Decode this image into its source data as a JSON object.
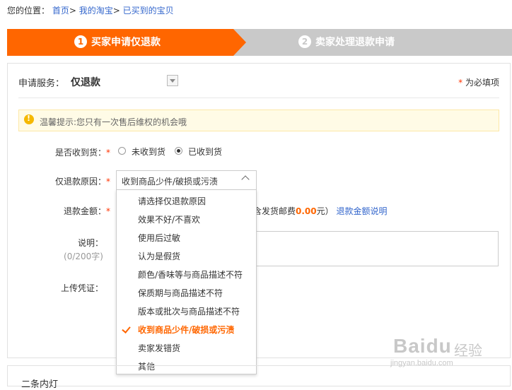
{
  "breadcrumb": {
    "prefix": "您的位置：",
    "items": [
      "首页",
      "我的淘宝",
      "已买到的宝贝"
    ],
    "sep": ">"
  },
  "steps": [
    {
      "num": "1",
      "label": "买家申请仅退款"
    },
    {
      "num": "2",
      "label": "卖家处理退款申请"
    }
  ],
  "service": {
    "label": "申请服务：",
    "value": "仅退款"
  },
  "required_note": {
    "star": "*",
    "text": " 为必填项"
  },
  "tip": "温馨提示:您只有一次售后维权的机会哦",
  "form": {
    "received_label": "是否收到货：",
    "received_options": [
      "未收到货",
      "已收到货"
    ],
    "received_selected": "已收到货",
    "reason_label": "仅退款原因：",
    "reason_value": "收到商品少件/破损或污渍",
    "amount_label": "退款金额：",
    "amount_tail_prefix": "含发货邮费",
    "amount_fee": "0.00",
    "amount_tail_suffix": "元）",
    "amount_link": "退款金额说明",
    "desc_label": "说明：",
    "desc_sub": "(0/200字)",
    "upload_label": "上传凭证：",
    "star": "*"
  },
  "dropdown_options": [
    "请选择仅退款原因",
    "效果不好/不喜欢",
    "使用后过敏",
    "认为是假货",
    "颜色/香味等与商品描述不符",
    "保质期与商品描述不符",
    "版本或批次与商品描述不符",
    "收到商品少件/破损或污渍",
    "卖家发错货",
    "其他"
  ],
  "dropdown_selected_index": 7,
  "panel2_title": "二条内灯",
  "watermark": {
    "logo": "Baidu",
    "cn": "经验",
    "url": "jingyan.baidu.com"
  },
  "colors": {
    "accent": "#ff6600",
    "link": "#3366cc",
    "step_inactive": "#c9c9c9"
  }
}
